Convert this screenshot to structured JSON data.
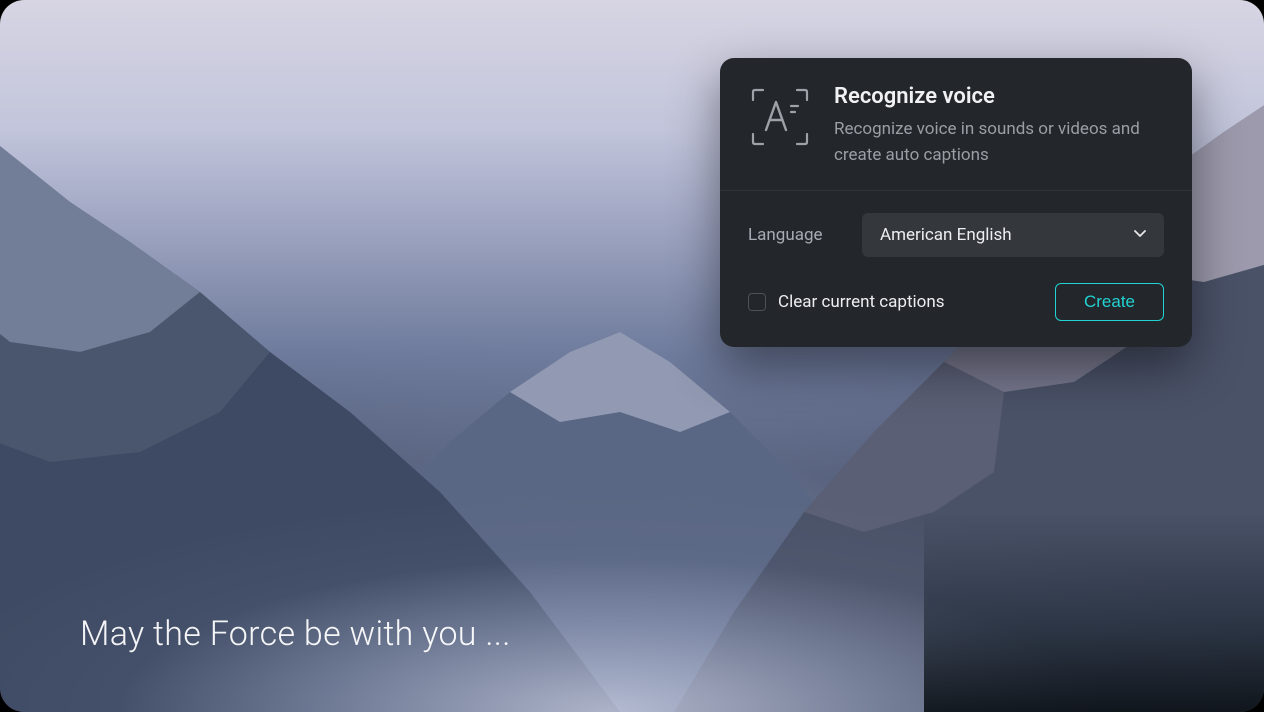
{
  "panel": {
    "title": "Recognize voice",
    "subtitle": "Recognize voice in sounds or videos and create auto captions",
    "language_label": "Language",
    "language_selected": "American English",
    "clear_captions_label": "Clear current captions",
    "clear_captions_checked": false,
    "create_button_label": "Create",
    "icon_name": "letter-a-scan-icon",
    "accent_color": "#22d3d3"
  },
  "caption": {
    "text": "May the Force be with you ..."
  }
}
